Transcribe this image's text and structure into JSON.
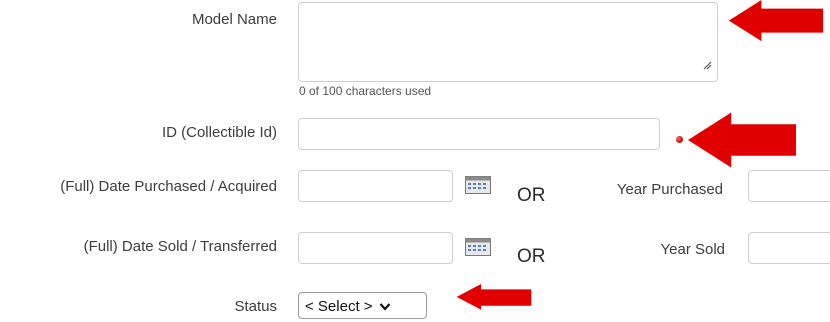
{
  "form": {
    "model_name": {
      "label": "Model Name",
      "value": "",
      "counter": "0 of 100 characters used"
    },
    "collectible_id": {
      "label": "ID (Collectible Id)",
      "value": ""
    },
    "date_purchased": {
      "label": "(Full) Date Purchased / Acquired",
      "value": "",
      "calendar_icon": "calendar-icon"
    },
    "year_purchased": {
      "label": "Year Purchased",
      "value": ""
    },
    "date_sold": {
      "label": "(Full) Date Sold / Transferred",
      "value": "",
      "calendar_icon": "calendar-icon"
    },
    "year_sold": {
      "label": "Year Sold",
      "value": ""
    },
    "or_text": "OR",
    "status": {
      "label": "Status",
      "selected": "< Select >"
    }
  },
  "annotations": {
    "arrow_color": "#e00000",
    "required_dot_color": "#c40000"
  }
}
